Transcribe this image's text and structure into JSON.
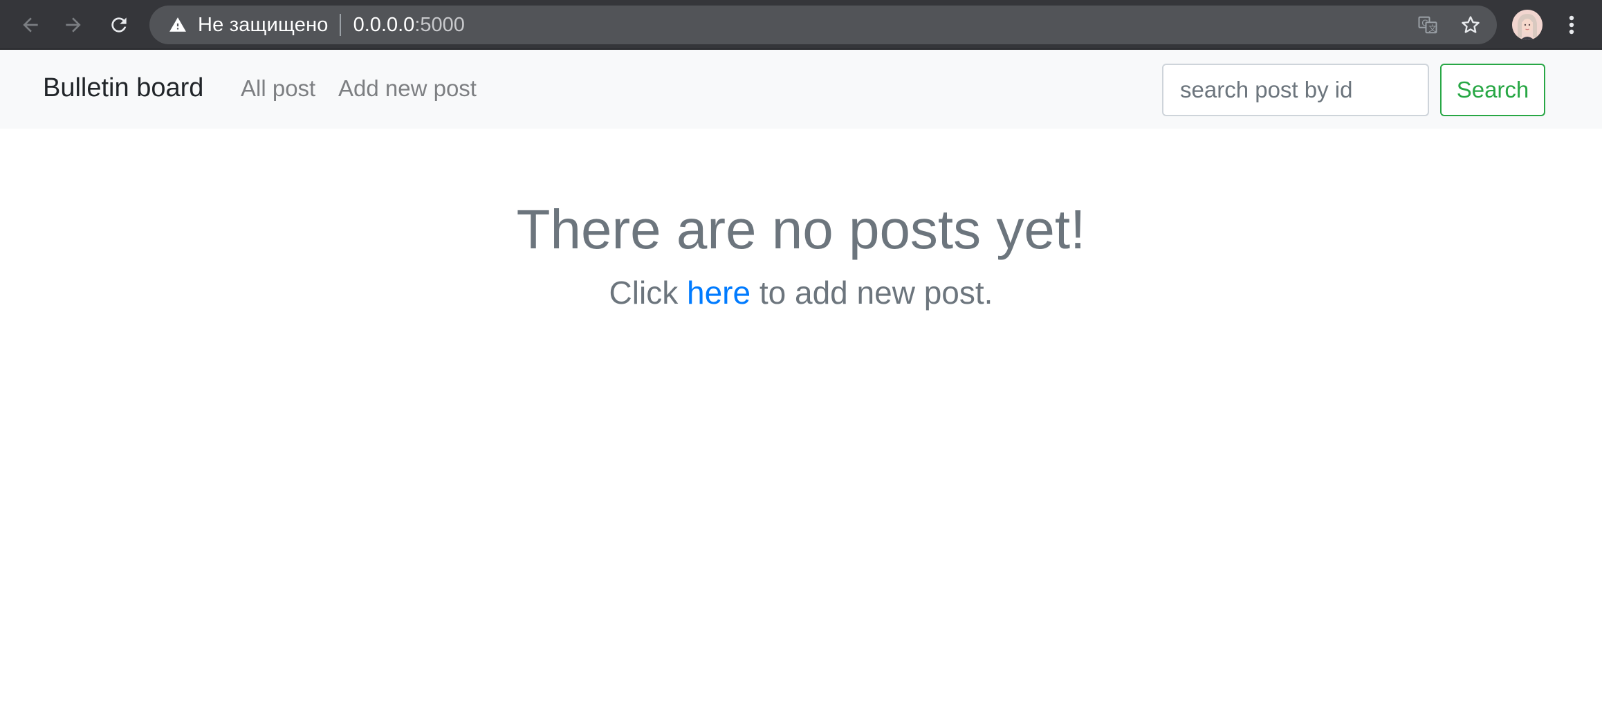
{
  "browser": {
    "security_label": "Не защищено",
    "url_host": "0.0.0.0",
    "url_port": ":5000",
    "icons": [
      "back-icon",
      "forward-icon",
      "reload-icon",
      "warning-icon",
      "translate-icon",
      "star-icon",
      "avatar",
      "more-vert-icon"
    ]
  },
  "navbar": {
    "brand": "Bulletin board",
    "links": [
      {
        "label": "All post"
      },
      {
        "label": "Add new post"
      }
    ],
    "search": {
      "placeholder": "search post by id",
      "value": "",
      "button_label": "Search"
    }
  },
  "main": {
    "heading": "There are no posts yet!",
    "sub_before": "Click ",
    "sub_link": "here",
    "sub_after": " to add new post."
  },
  "colors": {
    "chrome_bg": "#35363a",
    "omnibox_bg": "#525458",
    "navbar_bg": "#f8f9fa",
    "muted_text": "#6c757d",
    "link": "#007bff",
    "success": "#28a745"
  }
}
